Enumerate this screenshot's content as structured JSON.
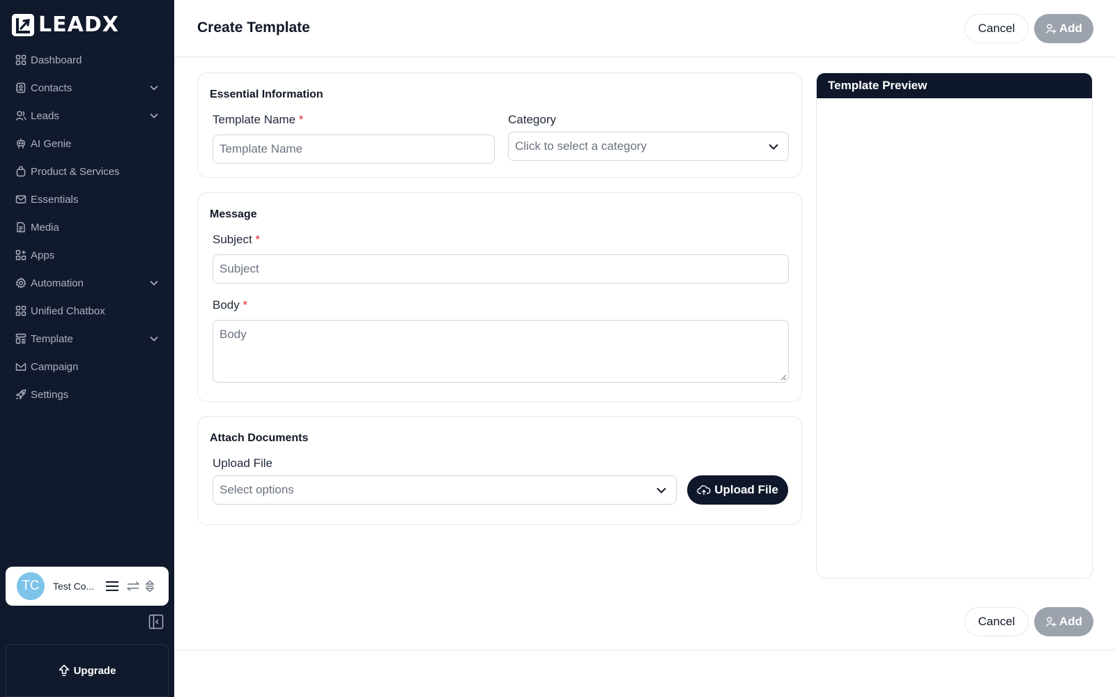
{
  "app": {
    "logo_text": "LEADX"
  },
  "sidebar": {
    "items": [
      {
        "label": "Dashboard",
        "icon": "grid-icon",
        "has_chevron": false
      },
      {
        "label": "Contacts",
        "icon": "contacts-icon",
        "has_chevron": true
      },
      {
        "label": "Leads",
        "icon": "users-icon",
        "has_chevron": true
      },
      {
        "label": "AI Genie",
        "icon": "robot-icon",
        "has_chevron": false
      },
      {
        "label": "Product & Services",
        "icon": "bag-icon",
        "has_chevron": false
      },
      {
        "label": "Essentials",
        "icon": "mail-icon",
        "has_chevron": false
      },
      {
        "label": "Media",
        "icon": "file-icon",
        "has_chevron": false
      },
      {
        "label": "Apps",
        "icon": "apps-icon",
        "has_chevron": false
      },
      {
        "label": "Automation",
        "icon": "gear-icon",
        "has_chevron": true
      },
      {
        "label": "Unified Chatbox",
        "icon": "grid-icon",
        "has_chevron": false
      },
      {
        "label": "Template",
        "icon": "template-icon",
        "has_chevron": true
      },
      {
        "label": "Campaign",
        "icon": "campaign-mail-icon",
        "has_chevron": false
      },
      {
        "label": "Settings",
        "icon": "rocket-icon",
        "has_chevron": false
      }
    ],
    "user": {
      "initials": "TC",
      "name": "Test Co..."
    },
    "upgrade_label": "Upgrade"
  },
  "header": {
    "title": "Create Template",
    "cancel_label": "Cancel",
    "add_label": "Add"
  },
  "essential": {
    "title": "Essential Information",
    "template_name_label": "Template Name",
    "template_name_placeholder": "Template Name",
    "category_label": "Category",
    "category_placeholder": "Click to select a category",
    "required_mark": "*"
  },
  "message": {
    "title": "Message",
    "subject_label": "Subject",
    "subject_placeholder": "Subject",
    "body_label": "Body",
    "body_placeholder": "Body",
    "required_mark": "*"
  },
  "attach": {
    "title": "Attach Documents",
    "upload_label": "Upload File",
    "select_placeholder": "Select options",
    "upload_button_label": "Upload File"
  },
  "preview": {
    "title": "Template Preview"
  },
  "footer": {
    "cancel_label": "Cancel",
    "add_label": "Add"
  },
  "colors": {
    "sidebar_bg": "#111a2c",
    "primary_dark": "#0f172a",
    "disabled_button": "#9ca3ad",
    "required": "#dc2626",
    "avatar": "#7ec3ea"
  }
}
